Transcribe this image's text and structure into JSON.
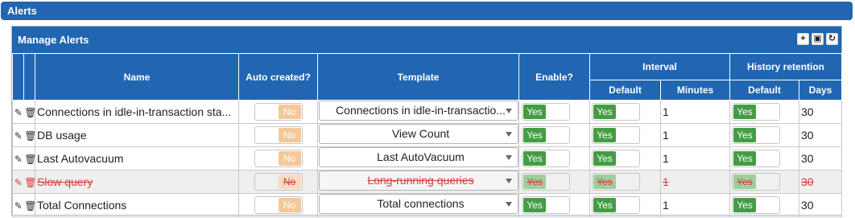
{
  "title": "Alerts",
  "panel": {
    "title": "Manage Alerts",
    "tools": [
      "add-icon",
      "save-icon",
      "refresh-icon"
    ]
  },
  "columns": {
    "name": "Name",
    "auto_created": "Auto created?",
    "template": "Template",
    "enable": "Enable?",
    "interval": "Interval",
    "interval_default": "Default",
    "interval_minutes": "Minutes",
    "history": "History retention",
    "history_default": "Default",
    "history_days": "Days"
  },
  "rows": [
    {
      "name": "Connections in idle-in-transaction sta...",
      "auto_created": "No",
      "template": "Connections in idle-in-transactio...",
      "enable": "Yes",
      "interval_default": "Yes",
      "minutes": "1",
      "history_default": "Yes",
      "days": "30",
      "disabled": false
    },
    {
      "name": "DB usage",
      "auto_created": "No",
      "template": "View Count",
      "enable": "Yes",
      "interval_default": "Yes",
      "minutes": "1",
      "history_default": "Yes",
      "days": "30",
      "disabled": false
    },
    {
      "name": "Last Autovacuum",
      "auto_created": "No",
      "template": "Last AutoVacuum",
      "enable": "Yes",
      "interval_default": "Yes",
      "minutes": "1",
      "history_default": "Yes",
      "days": "30",
      "disabled": false
    },
    {
      "name": "Slow query",
      "auto_created": "No",
      "template": "Long-running queries",
      "enable": "Yes",
      "interval_default": "Yes",
      "minutes": "1",
      "history_default": "Yes",
      "days": "30",
      "disabled": true
    },
    {
      "name": "Total Connections",
      "auto_created": "No",
      "template": "Total connections",
      "enable": "Yes",
      "interval_default": "Yes",
      "minutes": "1",
      "history_default": "Yes",
      "days": "30",
      "disabled": false
    }
  ],
  "colors": {
    "header": "#2166b0",
    "toggle_on": "#449d44",
    "toggle_off": "#f5c89a",
    "strike": "#d63d3d"
  }
}
